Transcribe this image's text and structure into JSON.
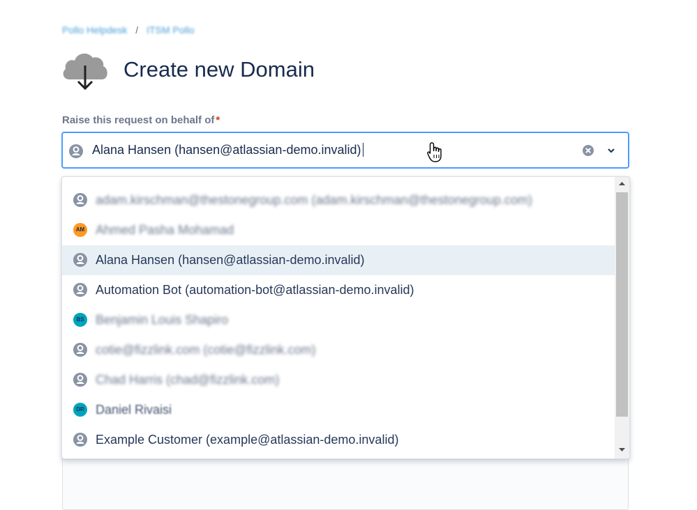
{
  "breadcrumb": {
    "items": [
      "Pollo Helpdesk",
      "ITSM Pollo"
    ],
    "separator": "/"
  },
  "page": {
    "title": "Create new Domain",
    "icon": "cloud-download-icon"
  },
  "form": {
    "field_label": "Raise this request on behalf of",
    "required_marker": "*",
    "select_value": "Alana Hansen (hansen@atlassian-demo.invalid)"
  },
  "dropdown": {
    "options": [
      {
        "label": "adam.kirschman@thestonegroup.com (adam.kirschman@thestonegroup.com)",
        "icon": "user-icon"
      },
      {
        "label": "Ahmed Pasha Mohamad",
        "avatar": "AM",
        "avatar_color": "#ff991f"
      },
      {
        "label": "Alana Hansen (hansen@atlassian-demo.invalid)",
        "icon": "user-icon",
        "selected": true
      },
      {
        "label": "Automation Bot (automation-bot@atlassian-demo.invalid)",
        "icon": "user-icon"
      },
      {
        "label": "Benjamin Louis Shapiro",
        "avatar": "BS",
        "avatar_color": "#00a3bf"
      },
      {
        "label": "cotie@fizzlink.com (cotie@fizzlink.com)",
        "icon": "user-icon"
      },
      {
        "label": "Chad Harris (chad@fizzlink.com)",
        "icon": "user-icon"
      },
      {
        "label": "Daniel Rivaisi",
        "avatar": "DR",
        "avatar_color": "#00a3bf"
      },
      {
        "label": "Example Customer (example@atlassian-demo.invalid)",
        "icon": "user-icon"
      }
    ]
  },
  "colors": {
    "focus_border": "#4c9aff",
    "selected_row": "#e8f0f6",
    "required": "#de350b",
    "title": "#172b4d"
  }
}
